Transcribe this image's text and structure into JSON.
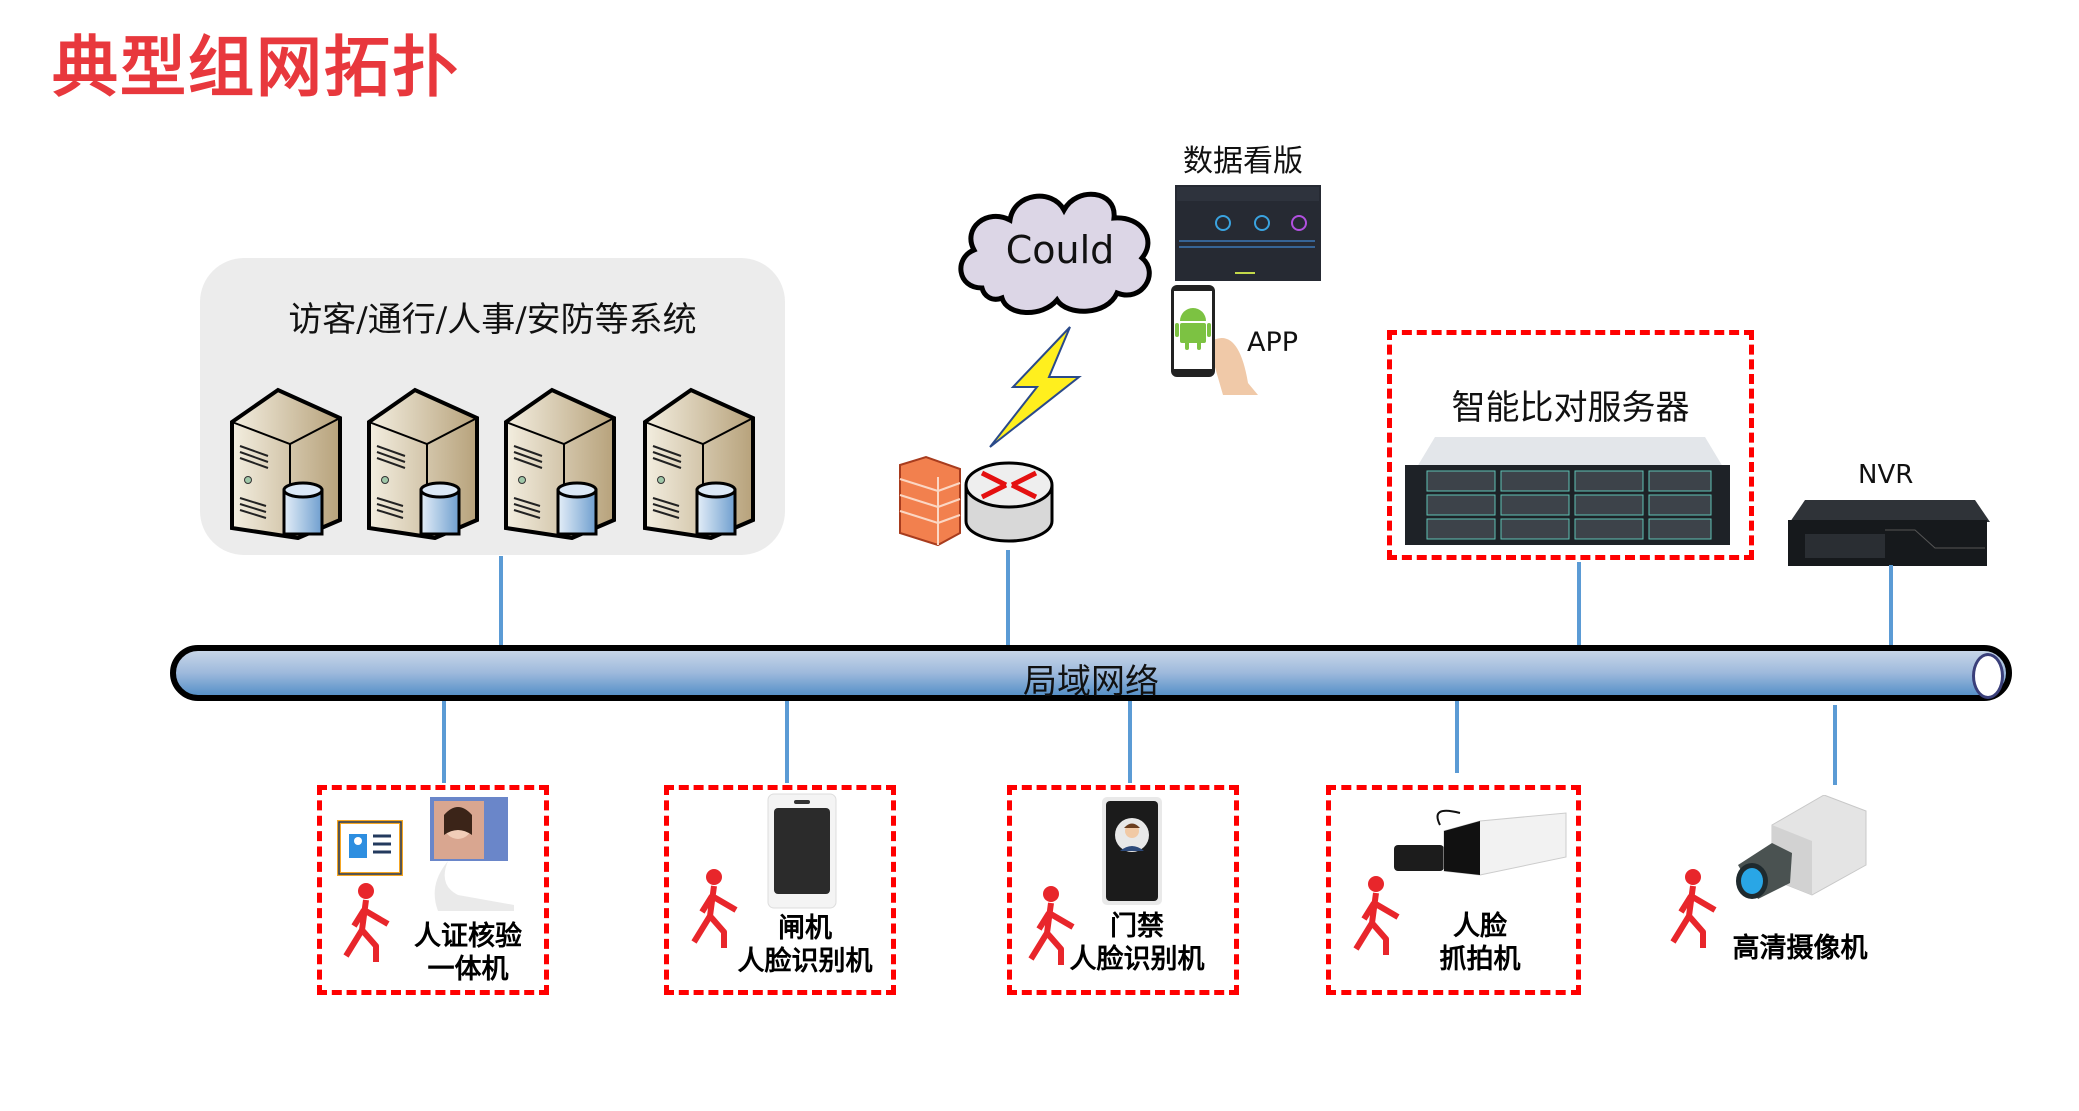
{
  "title": "典型组网拓扑",
  "systems_group": {
    "label": "访客/通行/人事/安防等系统",
    "servers": [
      "server-1",
      "server-2",
      "server-3",
      "server-4"
    ]
  },
  "cloud": {
    "label": "Could"
  },
  "dashboard": {
    "label": "数据看版"
  },
  "app": {
    "label": "APP"
  },
  "smart_server": {
    "label": "智能比对服务器"
  },
  "nvr": {
    "label": "NVR"
  },
  "lan": {
    "label": "局域网络"
  },
  "devices": [
    {
      "line1": "人证核验",
      "line2": "一体机"
    },
    {
      "line1": "闸机",
      "line2": "人脸识别机"
    },
    {
      "line1": "门禁",
      "line2": "人脸识别机"
    },
    {
      "line1": "人脸",
      "line2": "抓拍机"
    },
    {
      "line1": "高清摄像机",
      "line2": ""
    }
  ],
  "colors": {
    "title": "#e8383d",
    "link": "#5b9bd5",
    "dash": "#ff0000",
    "walker": "#e8262b"
  }
}
